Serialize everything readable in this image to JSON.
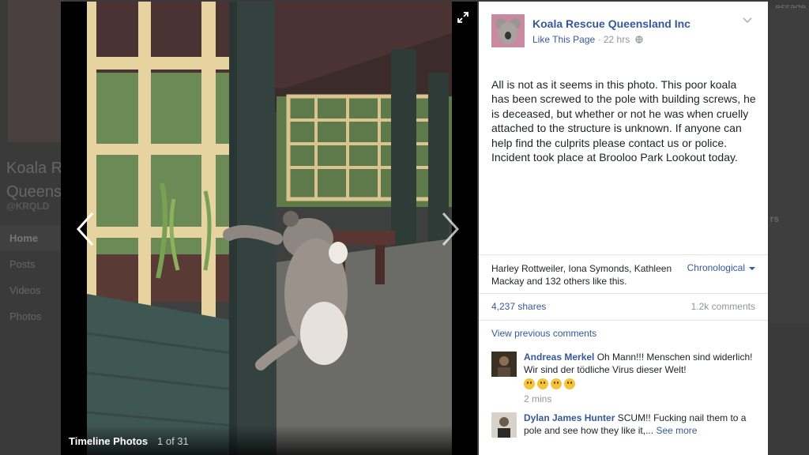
{
  "background_page": {
    "title_line1": "Koala R",
    "title_line2": "Queensl",
    "handle": "@KRQLD",
    "nav": [
      "Home",
      "Posts",
      "Videos",
      "Photos"
    ],
    "message_fragment": "essage",
    "right_fragment": "rs"
  },
  "viewer": {
    "album_name": "Timeline Photos",
    "photo_counter": "1 of 31"
  },
  "post": {
    "page_name": "Koala Rescue Queensland Inc",
    "like_page": "Like This Page",
    "separator": " · ",
    "time": "22 hrs",
    "privacy_icon": "globe-icon",
    "text": "All is not as it seems in this photo. This poor koala has been screwed to the pole with building screws, he is deceased, but whether or not he was when cruelly attached to the structure is unknown. If anyone can help find the culprits please contact us or police. Incident took place at Brooloo Park Lookout today."
  },
  "engagement": {
    "likers": "Harley Rottweiler, Iona Symonds, Kathleen Mackay and 132 others like this.",
    "order_label": "Chronological",
    "shares": "4,237 shares",
    "comments_count": "1.2k comments",
    "view_previous": "View previous comments"
  },
  "comments": [
    {
      "author": "Andreas Merkel",
      "text": "Oh Mann!!! Menschen sind widerlich! Wir sind der tödliche Virus dieser Welt!",
      "emoji_count": 4,
      "time": "2 mins"
    },
    {
      "author": "Dylan James Hunter",
      "text": "SCUM!! Fucking nail them to a pole and see how they like it,...",
      "see_more": "See more"
    }
  ],
  "colors": {
    "link": "#365899",
    "muted": "#90949c",
    "text": "#1d2129",
    "backdrop": "#2b2b2b"
  }
}
